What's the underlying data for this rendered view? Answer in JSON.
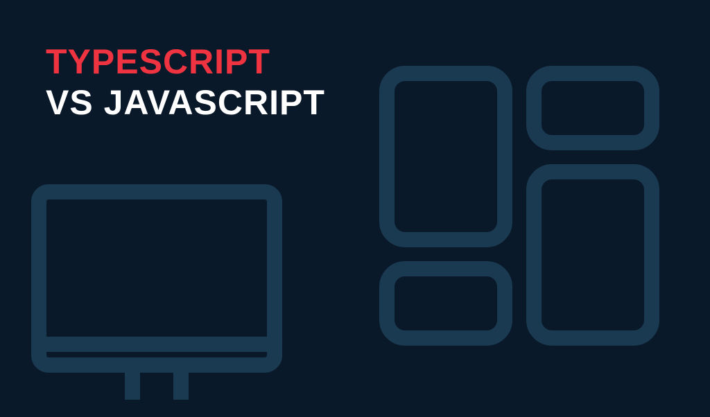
{
  "colors": {
    "background": "#0a1929",
    "accent_red": "#ef3340",
    "white": "#ffffff",
    "shape_outline": "#1a3a52"
  },
  "heading": {
    "line1": "TYPESCRIPT",
    "line2": "VS JAVASCRIPT"
  },
  "icons": {
    "monitor": "monitor-icon",
    "grid": "grid-layout-icon"
  }
}
